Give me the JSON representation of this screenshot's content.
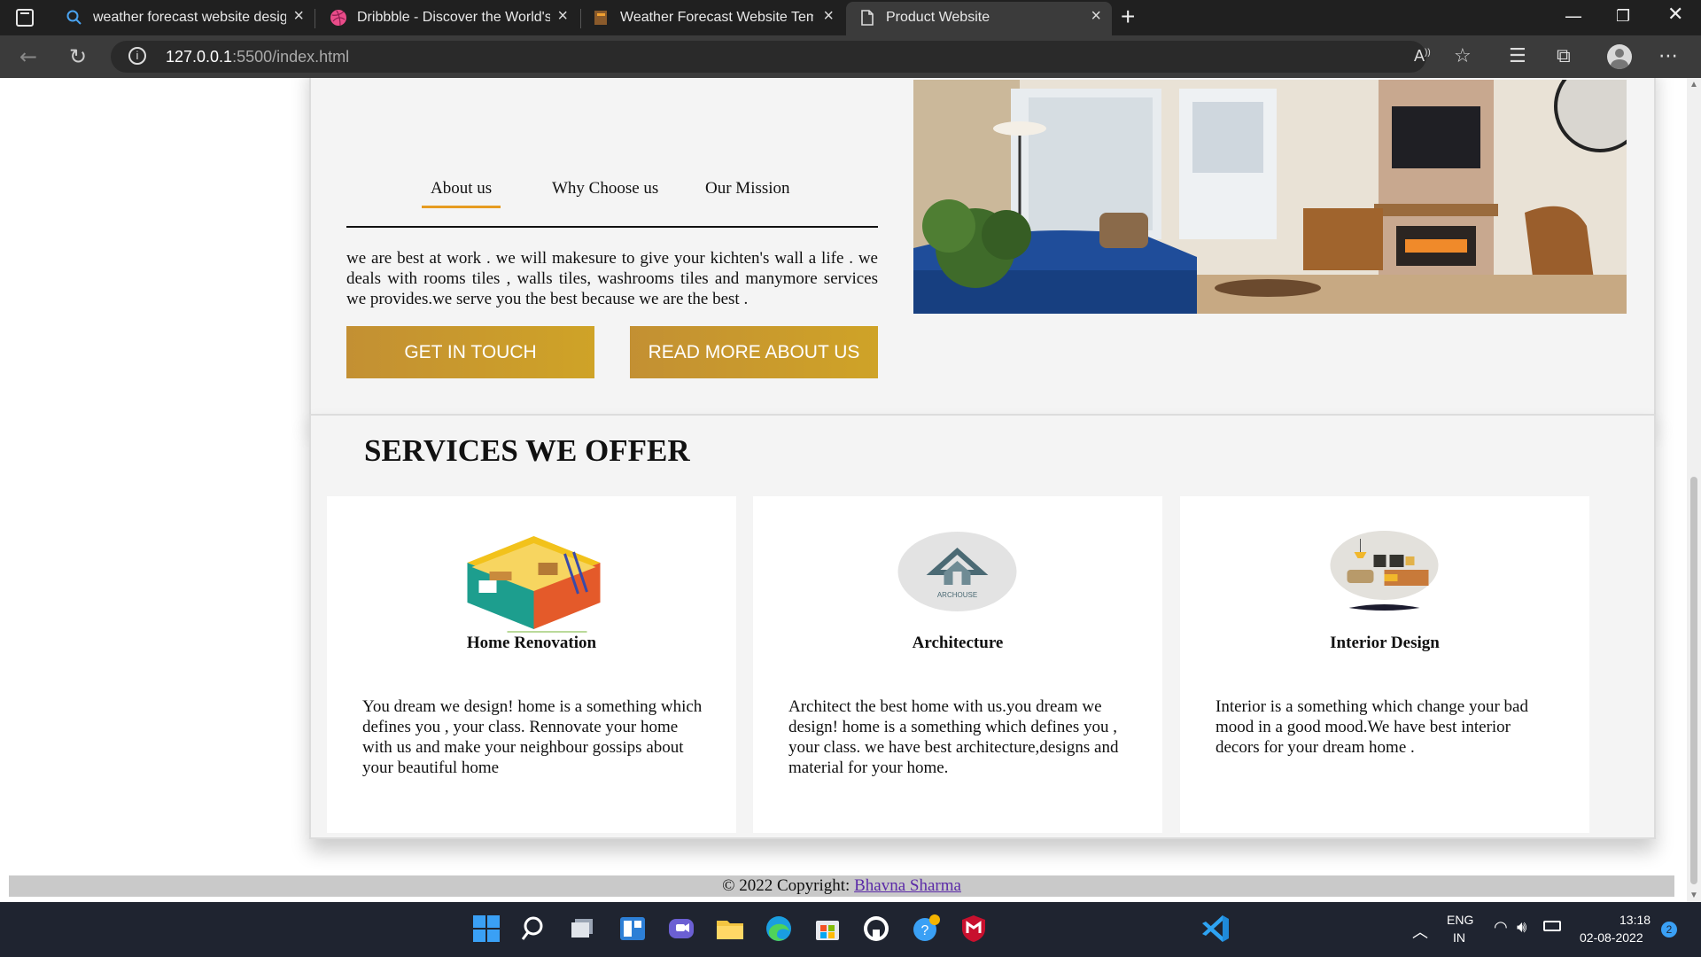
{
  "browser": {
    "tabs": [
      {
        "title": "weather forecast website design",
        "icon": "search-icon"
      },
      {
        "title": "Dribbble - Discover the World's Top Designers",
        "icon": "dribbble-icon"
      },
      {
        "title": "Weather Forecast Website Template",
        "icon": "site-favicon"
      },
      {
        "title": "Product Website",
        "icon": "page-icon",
        "active": true
      }
    ],
    "url_host": "127.0.0.1",
    "url_path": ":5500/index.html"
  },
  "about": {
    "tabs": [
      "About us",
      "Why Choose us",
      "Our Mission"
    ],
    "active_tab": "About us",
    "text": "we are best at work . we will makesure to give your kichten's wall a life . we deals with rooms tiles , walls tiles, washrooms tiles and manymore services we provides.we serve you the best because we are the best .",
    "btn_contact": "GET IN TOUCH",
    "btn_read_more": "READ MORE ABOUT US"
  },
  "services": {
    "title": "SERVICES WE OFFER",
    "items": [
      {
        "name": "Home Renovation",
        "desc": "You dream we design! home is a something which defines you , your class. Rennovate your home with us and make your neighbour gossips about your beautiful home"
      },
      {
        "name": "Architecture",
        "desc": "Architect the best home with us.you dream we design! home is a something which defines you , your class. we have best architecture,designs and material for your home.",
        "logo_text": "ARCHOUSE"
      },
      {
        "name": "Interior Design",
        "desc": "Interior is a something which change your bad mood in a good mood.We have best interior decors for your dream home ."
      }
    ]
  },
  "footer": {
    "copyright": "© 2022 Copyright: ",
    "author": "Bhavna Sharma"
  },
  "taskbar": {
    "lang_top": "ENG",
    "lang_bottom": "IN",
    "time": "13:18",
    "date": "02-08-2022",
    "notifications": "2"
  },
  "colors": {
    "accent_gold": "#c8992f",
    "tab_underline": "#e69c21",
    "link_purple": "#5b2aa8"
  }
}
